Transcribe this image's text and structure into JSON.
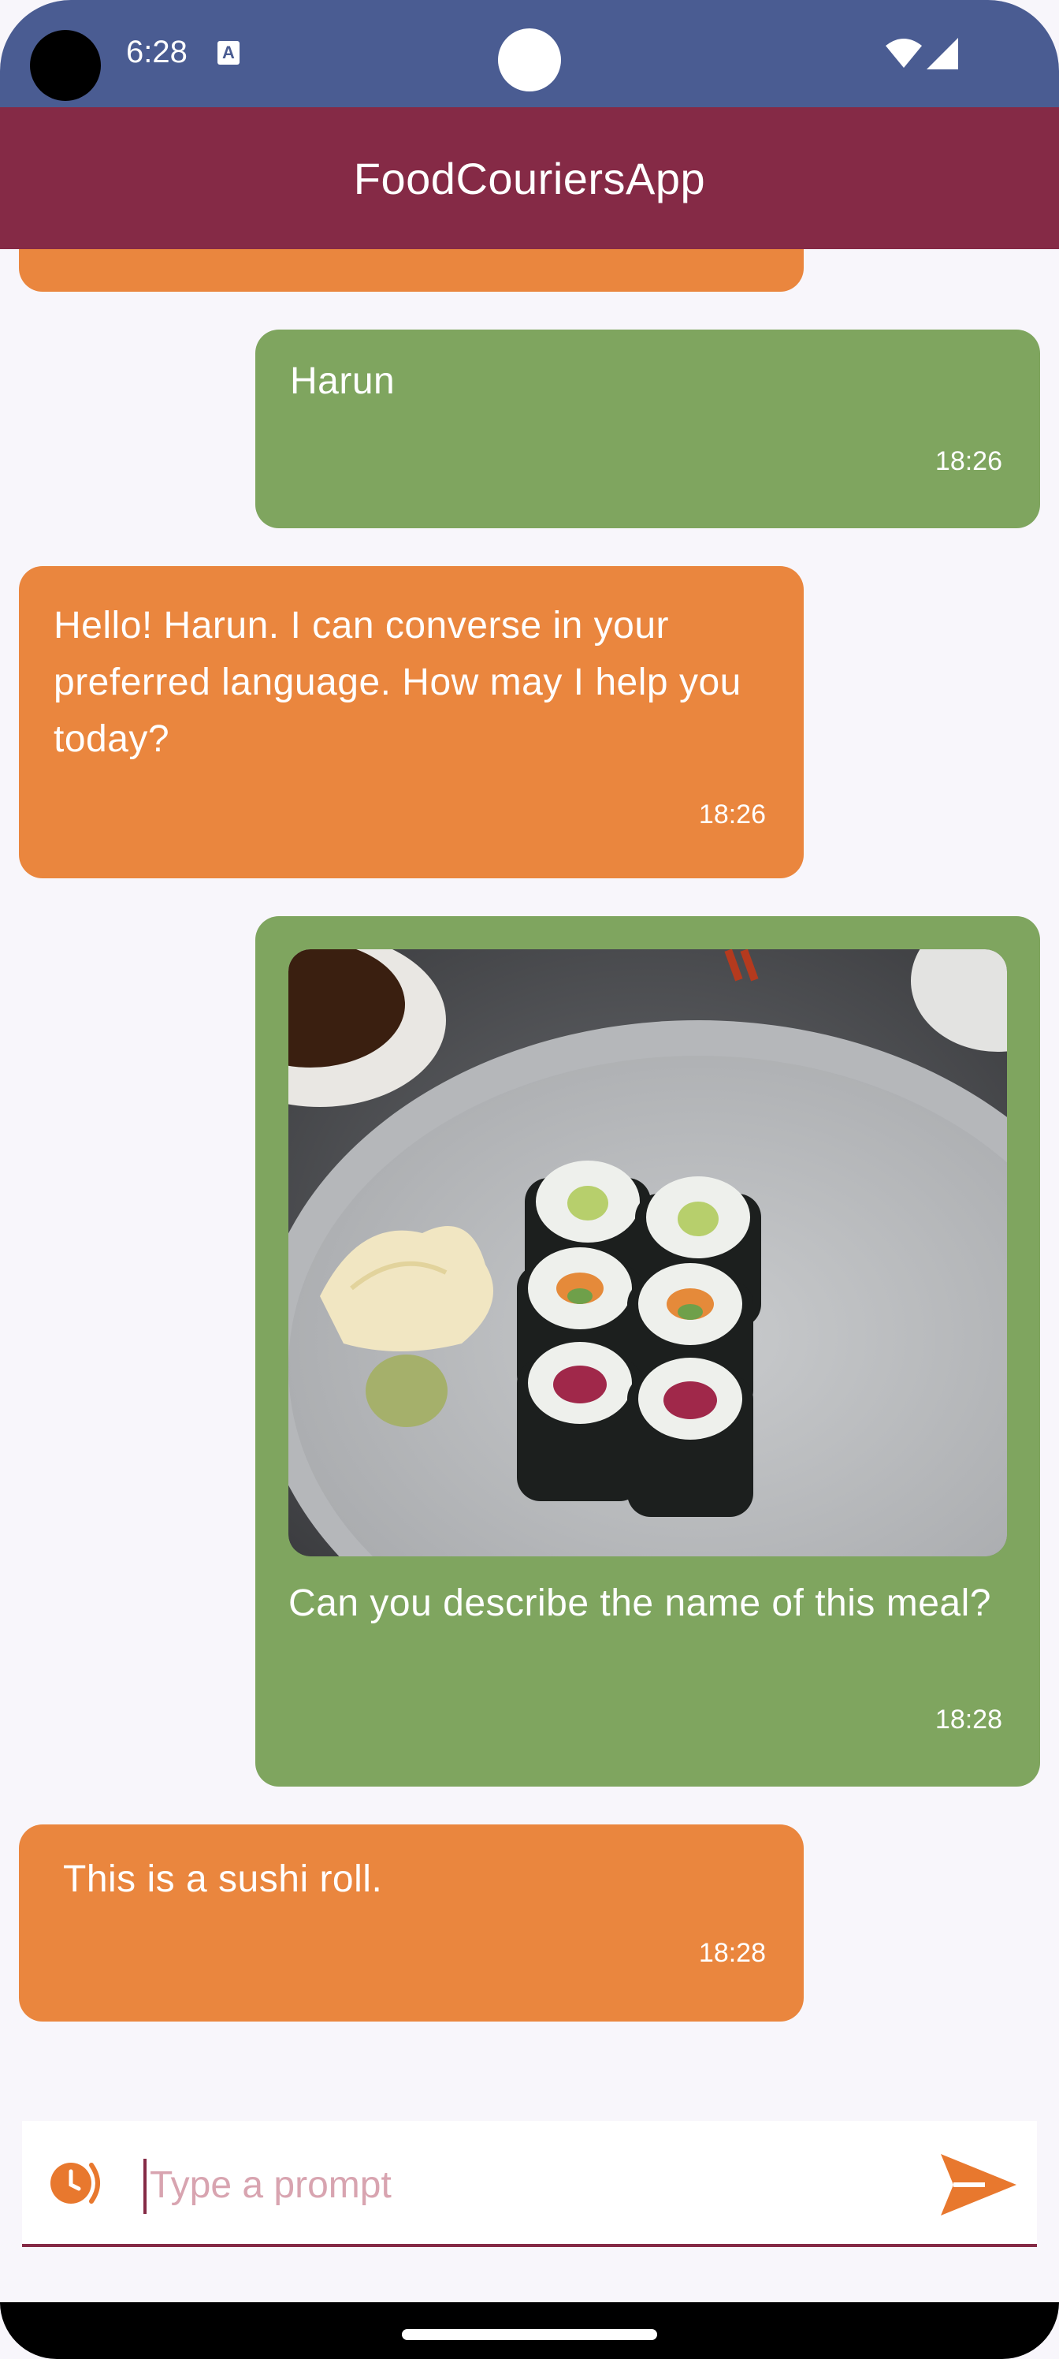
{
  "status_bar": {
    "time": "6:28",
    "notification_icon": "a-icon",
    "wifi_icon": "wifi-icon",
    "signal_icon": "signal-icon"
  },
  "app_bar": {
    "title": "FoodCouriersApp"
  },
  "messages": [
    {
      "sender": "user",
      "text": "Harun",
      "time": "18:26"
    },
    {
      "sender": "bot",
      "text": "Hello! Harun. I can converse in your preferred language. How may I help you today?",
      "time": "18:26"
    },
    {
      "sender": "user",
      "image": "sushi-photo",
      "text": "Can you describe the name of this meal?",
      "time": "18:28"
    },
    {
      "sender": "bot",
      "text": "This is a sushi roll.",
      "time": "18:28"
    }
  ],
  "input": {
    "placeholder": "Type a prompt",
    "value": "",
    "left_icon": "clock-icon",
    "send_icon": "send-icon"
  },
  "colors": {
    "status_bar": "#4a5c92",
    "app_bar": "#852a46",
    "bot_bubble": "#ea863e",
    "user_bubble": "#7fa55f",
    "accent": "#e8782e"
  }
}
